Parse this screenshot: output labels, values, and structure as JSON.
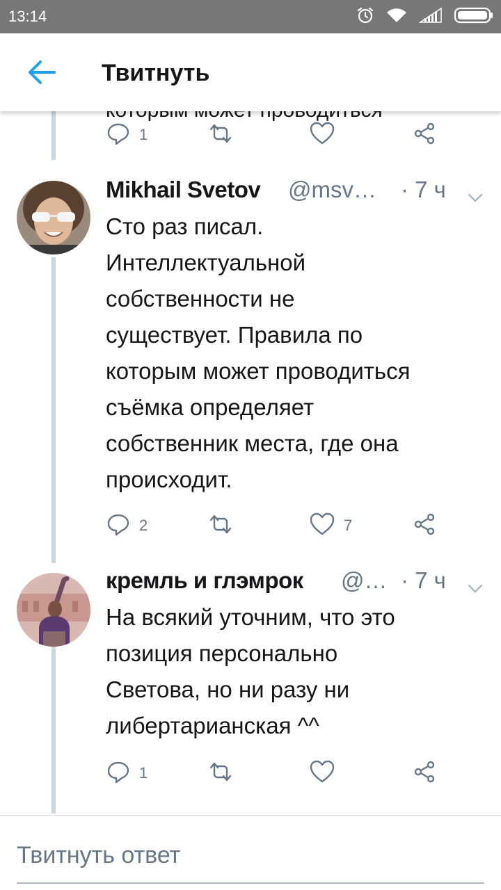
{
  "status_bar": {
    "time": "13:14",
    "icons": [
      "alarm-icon",
      "wifi-icon",
      "signal-icon",
      "battery-icon"
    ]
  },
  "app_bar": {
    "back_icon": "arrow-left-icon",
    "title": "Твитнуть",
    "accent_color": "#1da1f2"
  },
  "partial_tweet": {
    "text_fragment": "которым может проводиться",
    "actions": {
      "reply_count": "1",
      "retweet_count": "",
      "like_count": "",
      "share": ""
    }
  },
  "tweets": [
    {
      "name": "Mikhail Svetov",
      "handle": "@msv…",
      "time": "· 7 ч",
      "lines": [
        "Сто раз писал.",
        "Интеллектуальной",
        "собственности не",
        "существует. Правила по",
        "которым может проводиться",
        "съёмка определяет",
        "собственник места, где она",
        "происходит."
      ],
      "reply_count": "2",
      "retweet_count": "",
      "like_count": "7"
    },
    {
      "name": "кремль и глэмрок",
      "handle": "@…",
      "time": "· 7 ч",
      "lines": [
        "На всякий уточним, что это",
        "позиция персонально",
        "Светова, но ни разу ни",
        "либертарианская ^^"
      ],
      "reply_count": "1",
      "retweet_count": "",
      "like_count": ""
    }
  ],
  "reply_bar": {
    "placeholder": "Твитнуть ответ"
  },
  "colors": {
    "icon_gray": "#657786",
    "thread_line": "#ccd6dd",
    "status_bar_bg": "#777777"
  }
}
